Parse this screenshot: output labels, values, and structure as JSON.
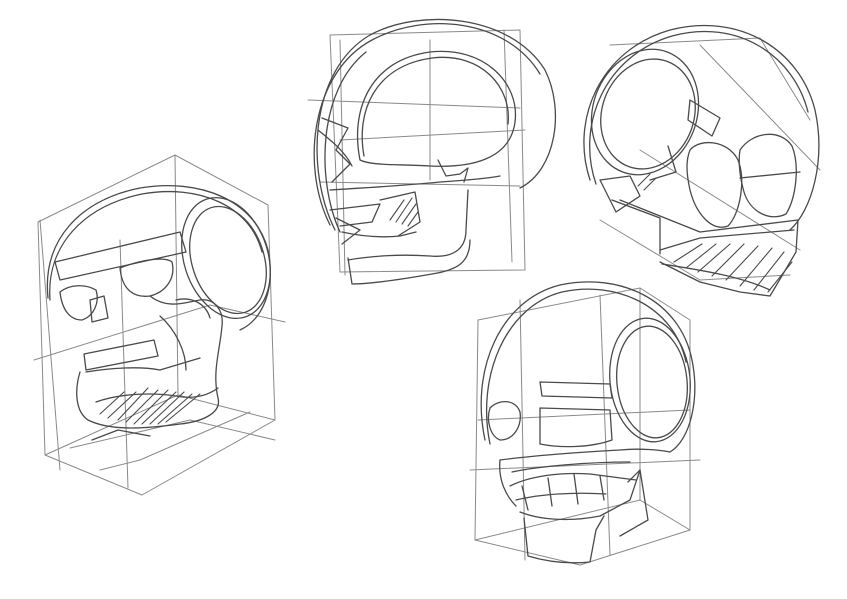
{
  "image": {
    "background": "#ffffff",
    "stroke_color": "#4a4a4a",
    "light_stroke_color": "#8a8a8a",
    "sketches": [
      {
        "id": "skull-three-quarter-low-left"
      },
      {
        "id": "skull-side-view-top-center"
      },
      {
        "id": "skull-tilted-back-top-right"
      },
      {
        "id": "skull-three-quarter-front-bottom-center"
      }
    ]
  }
}
